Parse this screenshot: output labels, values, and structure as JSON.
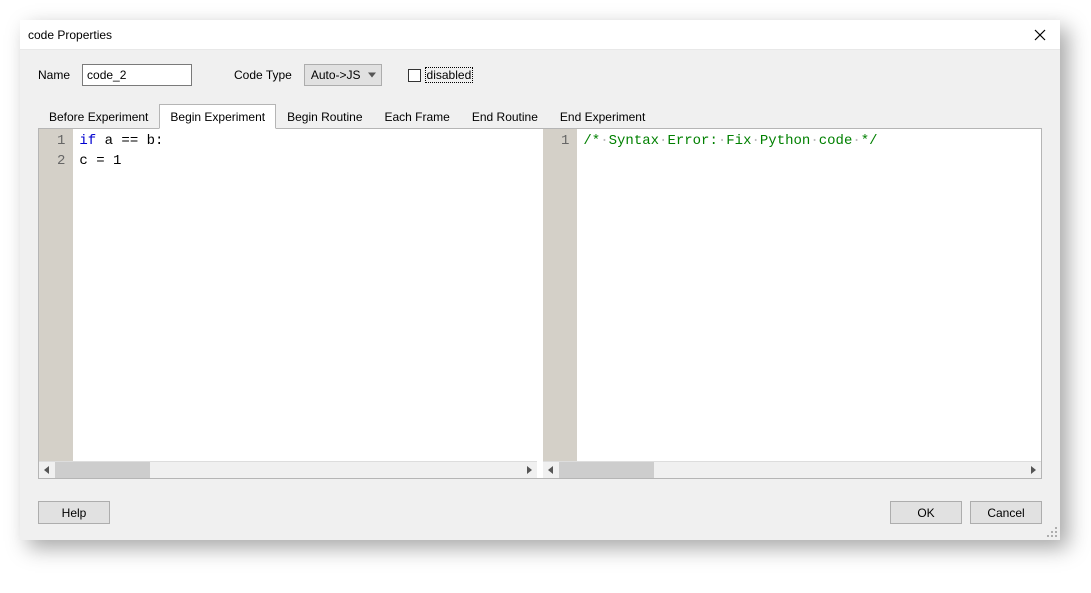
{
  "window": {
    "title": "code Properties"
  },
  "form": {
    "name_label": "Name",
    "name_value": "code_2",
    "codetype_label": "Code Type",
    "codetype_value": "Auto->JS",
    "disabled_label": "disabled",
    "disabled_checked": false
  },
  "tabs": [
    {
      "label": "Before Experiment",
      "active": false
    },
    {
      "label": "Begin Experiment",
      "active": true
    },
    {
      "label": "Begin Routine",
      "active": false
    },
    {
      "label": "Each Frame",
      "active": false
    },
    {
      "label": "End Routine",
      "active": false
    },
    {
      "label": "End Experiment",
      "active": false
    }
  ],
  "left_editor": {
    "line_numbers": [
      "1",
      "2"
    ],
    "lines": [
      {
        "tokens": [
          {
            "t": "if",
            "c": "kw"
          },
          {
            "t": " a == b:",
            "c": ""
          }
        ]
      },
      {
        "tokens": [
          {
            "t": "c = 1",
            "c": ""
          }
        ]
      }
    ]
  },
  "right_editor": {
    "line_numbers": [
      "1"
    ],
    "comment_parts": [
      "/*",
      "Syntax",
      "Error:",
      "Fix",
      "Python",
      "code",
      "*/"
    ]
  },
  "buttons": {
    "help": "Help",
    "ok": "OK",
    "cancel": "Cancel"
  }
}
